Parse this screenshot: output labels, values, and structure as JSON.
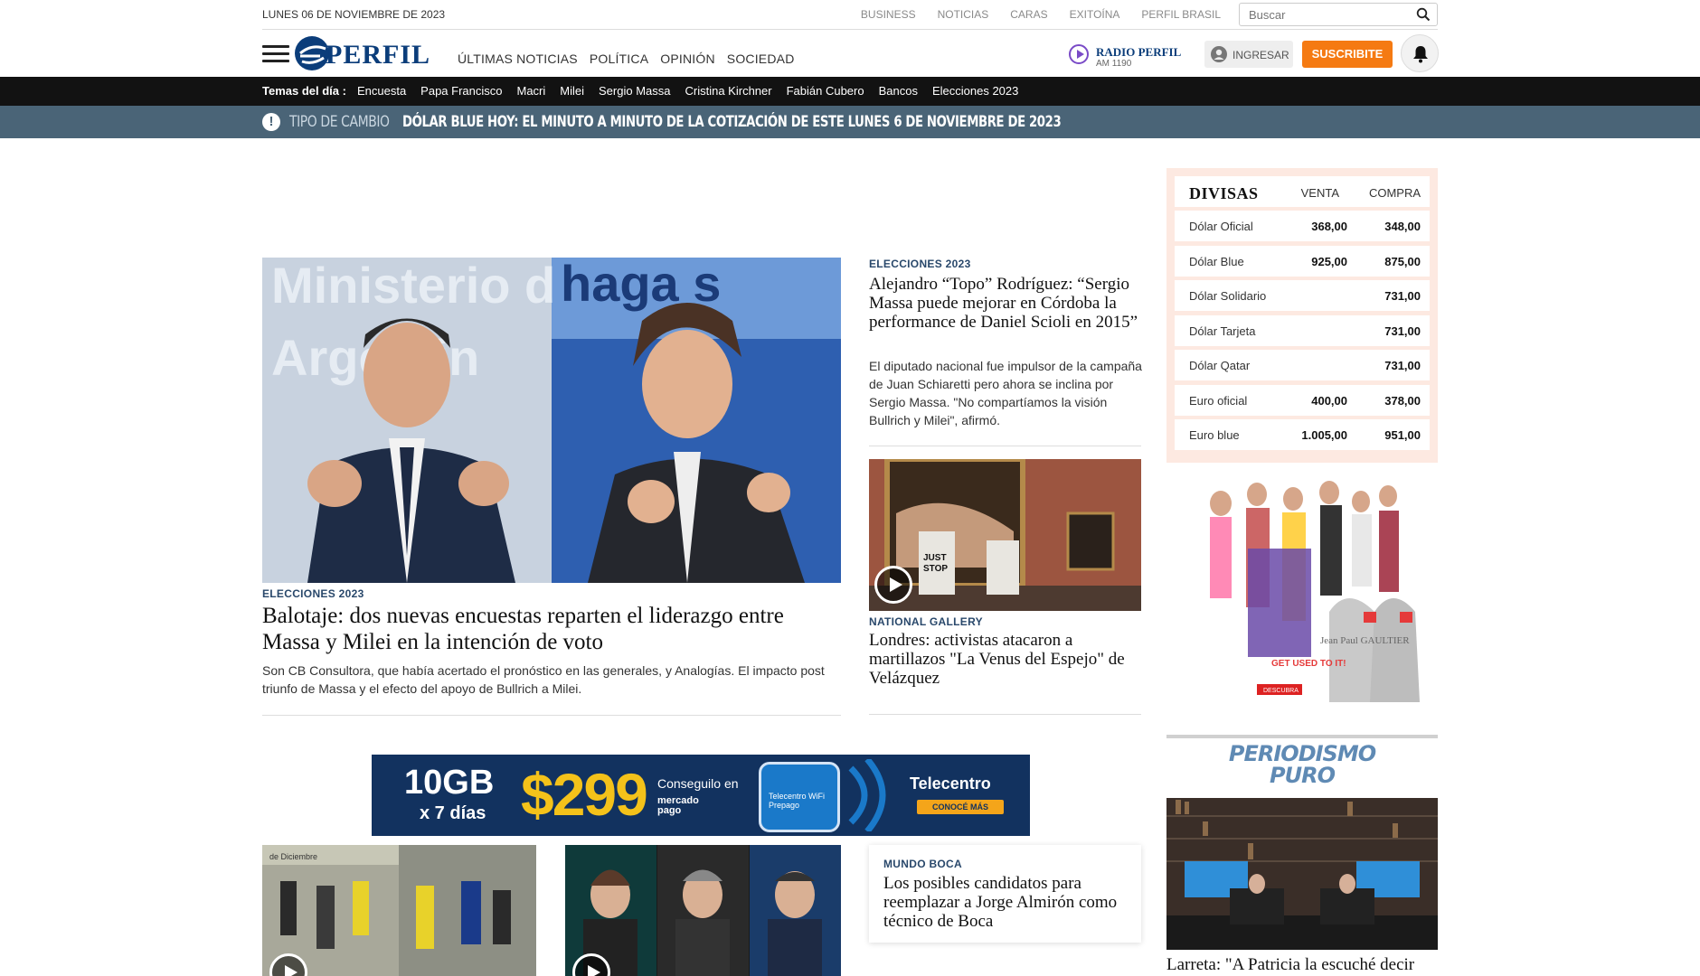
{
  "date": "LUNES 06 DE NOVIEMBRE DE 2023",
  "top_links": [
    "BUSINESS",
    "NOTICIAS",
    "CARAS",
    "EXITOÍNA",
    "PERFIL BRASIL"
  ],
  "search": {
    "placeholder": "Buscar"
  },
  "logo": {
    "text": "PERFIL"
  },
  "nav": [
    "ÚLTIMAS NOTICIAS",
    "POLÍTICA",
    "OPINIÓN",
    "SOCIEDAD"
  ],
  "radio": {
    "name": "RADIO PERFIL",
    "freq": "AM 1190"
  },
  "login_label": "INGRESAR",
  "subscribe_label": "SUSCRIBITE",
  "topics": {
    "label": "Temas del día :",
    "items": [
      "Encuesta",
      "Papa Francisco",
      "Macri",
      "Milei",
      "Sergio Massa",
      "Cristina Kirchner",
      "Fabián Cubero",
      "Bancos",
      "Elecciones 2023"
    ]
  },
  "breaking": {
    "tag": "TIPO DE CAMBIO",
    "headline": "DÓLAR BLUE HOY: EL MINUTO A MINUTO DE LA COTIZACIÓN DE ESTE LUNES 6 DE NOVIEMBRE DE 2023"
  },
  "main_story": {
    "kicker": "ELECCIONES 2023",
    "title": "Balotaje: dos nuevas encuestas reparten el liderazgo entre Massa y Milei en la intención de voto",
    "summary": "Son CB Consultora, que había acertado el pronóstico en las generales, y Analogías. El impacto post triunfo de Massa y el efecto del apoyo de Bullrich a Milei."
  },
  "side_story_1": {
    "kicker": "ELECCIONES 2023",
    "title": "Alejandro “Topo” Rodríguez: “Sergio Massa puede mejorar en Córdoba la performance de Daniel Scioli en 2015”",
    "summary": "El diputado nacional fue impulsor de la campaña de Juan Schiaretti pero ahora se inclina por Sergio Massa. \"No compartíamos la visión Bullrich y Milei\", afirmó."
  },
  "side_story_2": {
    "kicker": "NATIONAL GALLERY",
    "title": "Londres: activistas atacaron a martillazos \"La Venus del Espejo\" de Velázquez"
  },
  "divisas": {
    "title": "DIVISAS",
    "col_venta": "VENTA",
    "col_compra": "COMPRA",
    "rows": [
      {
        "name": "Dólar Oficial",
        "venta": "368,00",
        "compra": "348,00"
      },
      {
        "name": "Dólar Blue",
        "venta": "925,00",
        "compra": "875,00"
      },
      {
        "name": "Dólar Solidario",
        "venta": "",
        "compra": "731,00"
      },
      {
        "name": "Dólar Tarjeta",
        "venta": "",
        "compra": "731,00"
      },
      {
        "name": "Dólar Qatar",
        "venta": "",
        "compra": "731,00"
      },
      {
        "name": "Euro oficial",
        "venta": "400,00",
        "compra": "378,00"
      },
      {
        "name": "Euro blue",
        "venta": "1.005,00",
        "compra": "951,00"
      }
    ]
  },
  "ad_perfume": {
    "brand": "Jean Paul GAULTIER",
    "tagline": "GET USED TO IT!",
    "cta": "DESCUBRA"
  },
  "ad_banner": {
    "data": "10GB",
    "days": "x 7 días",
    "price": "$299",
    "consiguelo": "Conseguilo en",
    "mp_line1": "mercado",
    "mp_line2": "pago",
    "phone_label": "Telecentro WiFi Prepago",
    "brand": "Telecentro",
    "cta": "CONOCÉ MÁS"
  },
  "periodismo_puro": {
    "logo_line1": "PERIODISMO",
    "logo_line2": "PURO",
    "title": "Larreta: \"A Patricia la escuché decir"
  },
  "boca_story": {
    "kicker": "MUNDO BOCA",
    "title": "Los posibles candidatos para reemplazar a Jorge Almirón como técnico de Boca"
  },
  "ad_banner_thumb": {
    "sign": "de Diciembre"
  },
  "colors": {
    "brand_blue": "#0b3d7a",
    "accent_orange": "#f57a12",
    "kicker": "#29486b",
    "breaking_bar": "#4a6477",
    "divisas_bg": "#fde9e1"
  }
}
